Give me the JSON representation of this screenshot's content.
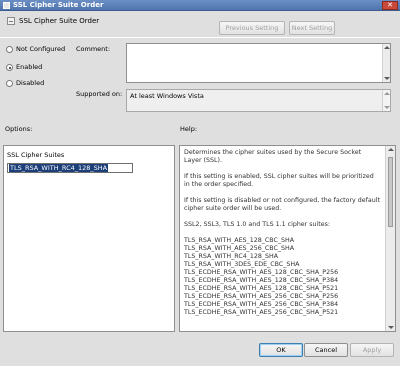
{
  "window": {
    "title": "SSL Cipher Suite Order",
    "close_glyph": "✕"
  },
  "header": {
    "title": "SSL Cipher Suite Order",
    "icon": "policy-setting-icon"
  },
  "nav": {
    "previous_label": "Previous Setting",
    "next_label": "Next Setting"
  },
  "state": {
    "options": [
      {
        "label": "Not Configured",
        "checked": false
      },
      {
        "label": "Enabled",
        "checked": true
      },
      {
        "label": "Disabled",
        "checked": false
      }
    ]
  },
  "comment": {
    "label": "Comment:",
    "value": ""
  },
  "supported": {
    "label": "Supported on:",
    "value": "At least Windows Vista"
  },
  "options_section": {
    "label": "Options:",
    "field_label": "SSL Cipher Suites",
    "field_value": "TLS_RSA_WITH_RC4_128_SHA"
  },
  "help_section": {
    "label": "Help:",
    "paragraphs": [
      "Determines the cipher suites used by the Secure Socket Layer (SSL).",
      "If this setting is enabled, SSL cipher suites will be prioritized in the order specified.",
      "If this setting is disabled or not configured, the factory default cipher suite order will be used.",
      "SSL2, SSL3, TLS 1.0 and TLS 1.1 cipher suites:"
    ],
    "suites": [
      "TLS_RSA_WITH_AES_128_CBC_SHA",
      "TLS_RSA_WITH_AES_256_CBC_SHA",
      "TLS_RSA_WITH_RC4_128_SHA",
      "TLS_RSA_WITH_3DES_EDE_CBC_SHA",
      "TLS_ECDHE_RSA_WITH_AES_128_CBC_SHA_P256",
      "TLS_ECDHE_RSA_WITH_AES_128_CBC_SHA_P384",
      "TLS_ECDHE_RSA_WITH_AES_128_CBC_SHA_P521",
      "TLS_ECDHE_RSA_WITH_AES_256_CBC_SHA_P256",
      "TLS_ECDHE_RSA_WITH_AES_256_CBC_SHA_P384",
      "TLS_ECDHE_RSA_WITH_AES_256_CBC_SHA_P521"
    ]
  },
  "footer": {
    "ok_label": "OK",
    "cancel_label": "Cancel",
    "apply_label": "Apply"
  }
}
